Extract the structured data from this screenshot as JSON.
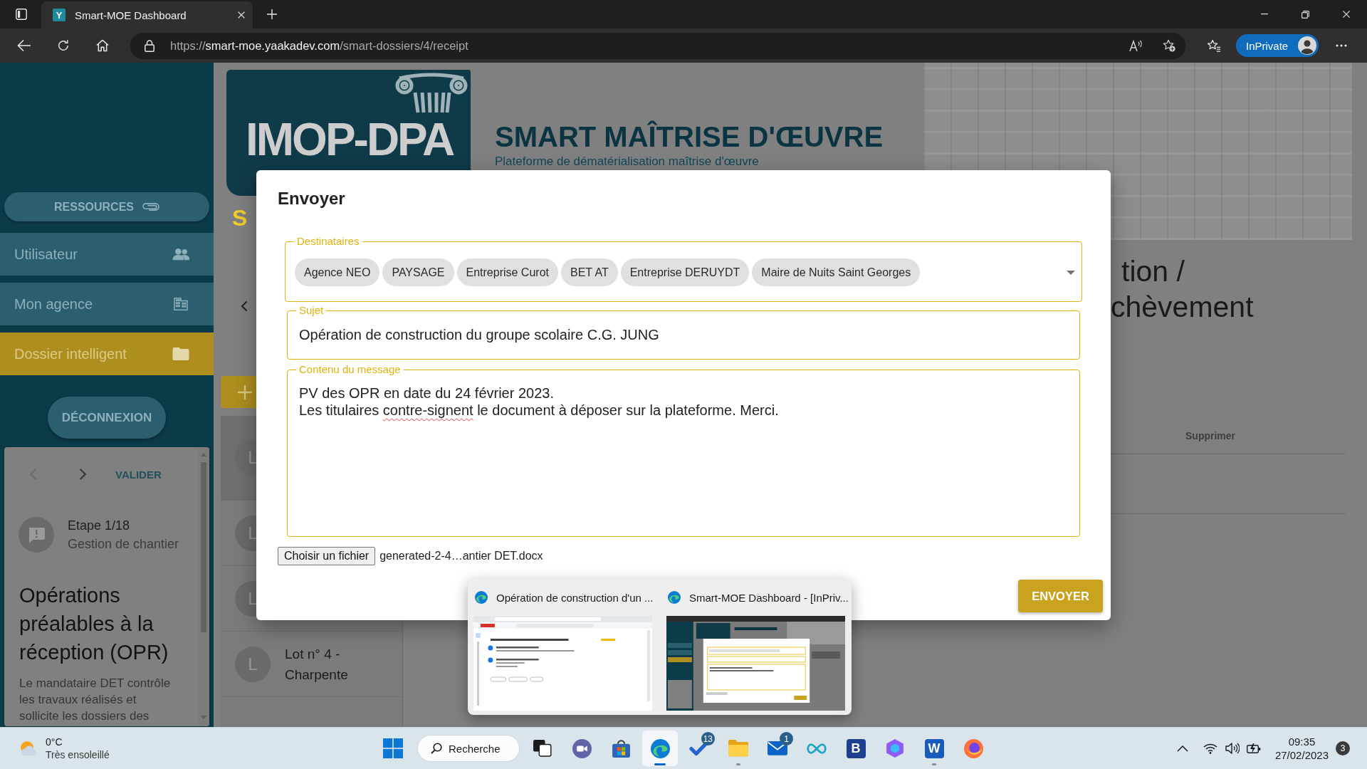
{
  "browser": {
    "tab": {
      "favicon_letter": "Y",
      "title": "Smart-MOE Dashboard",
      "selected": true
    },
    "url": {
      "scheme": "https://",
      "host": "smart-moe.yaakadev.com",
      "path": "/smart-dossiers/4/receipt"
    },
    "profile_button": "InPrivate"
  },
  "sidebar": {
    "resources_button": "RESSOURCES",
    "items": [
      {
        "kind": "users",
        "label": "Utilisateur",
        "selected": false
      },
      {
        "kind": "agency",
        "label": "Mon agence",
        "selected": false
      },
      {
        "kind": "dossier",
        "label": "Dossier intelligent",
        "selected": true
      }
    ],
    "logout_button": "DÉCONNEXION",
    "step_card": {
      "previous_disabled": true,
      "next_disabled": false,
      "validate_button": "VALIDER",
      "step": "Etape 1/18",
      "phase": "Gestion de chantier",
      "title": "Opérations préalables à la réception (OPR)",
      "description": "Le mandataire DET contrôle les travaux réalisés et sollicite les dossiers des"
    }
  },
  "header": {
    "logo_text": "IMOP-DPA",
    "logo_caption": "S",
    "title": "SMART MAÎTRISE D'ŒUVRE",
    "subtitle": "Plateforme de dématérialisation maîtrise d'œuvre"
  },
  "lots": {
    "rows": [
      {
        "avatar": "L",
        "selected": true
      },
      {
        "avatar": "L",
        "selected": false
      },
      {
        "avatar": "L",
        "selected": false
      },
      {
        "avatar": "L",
        "name": "Lot n° 4 - Charpente",
        "selected": false
      }
    ]
  },
  "page": {
    "heading_lines": [
      "tion /",
      "chèvement"
    ],
    "table": {
      "columns": [
        "Supprimer"
      ]
    }
  },
  "modal": {
    "title": "Envoyer",
    "recipients": {
      "label": "Destinataires",
      "chips": [
        "Agence NEO",
        "PAYSAGE",
        "Entreprise Curot",
        "BET AT",
        "Entreprise DERUYDT",
        "Maire de Nuits Saint Georges"
      ]
    },
    "subject": {
      "label": "Sujet",
      "value": "Opération de construction du groupe scolaire C.G. JUNG"
    },
    "message": {
      "label": "Contenu du message",
      "lines": [
        {
          "segments": [
            {
              "text": "PV des OPR en date du 24 février 2023.",
              "misspelled": false
            }
          ]
        },
        {
          "segments": [
            {
              "text": "Les titulaires ",
              "misspelled": false
            },
            {
              "text": "contre-signent",
              "misspelled": true
            },
            {
              "text": " le document à déposer sur la plateforme. Merci.",
              "misspelled": false
            }
          ]
        }
      ]
    },
    "file": {
      "button": "Choisir un fichier",
      "name": "generated-2-4…antier DET.docx"
    },
    "send_button": "ENVOYER"
  },
  "taskbar_preview": {
    "windows": [
      {
        "kind": "mail",
        "title": "Opération de construction d'un ..."
      },
      {
        "kind": "dashboard",
        "title": "Smart-MOE Dashboard - [InPriv..."
      }
    ]
  },
  "taskbar": {
    "weather": {
      "temperature": "0°C",
      "condition": "Très ensoleillé"
    },
    "search": "Recherche",
    "apps": [
      {
        "kind": "task-view",
        "selected": false,
        "open": false
      },
      {
        "kind": "chat",
        "selected": false,
        "open": false
      },
      {
        "kind": "store",
        "selected": false,
        "open": false
      },
      {
        "kind": "browser",
        "selected": true,
        "open": true
      },
      {
        "kind": "todo",
        "badge": "13",
        "selected": false,
        "open": false
      },
      {
        "kind": "files",
        "selected": false,
        "open": true
      },
      {
        "kind": "mail",
        "badge": "1",
        "selected": false,
        "open": false
      },
      {
        "kind": "infinity",
        "selected": false,
        "open": false
      },
      {
        "kind": "letter-app",
        "letter": "B",
        "selected": false,
        "open": false
      },
      {
        "kind": "hexagon",
        "selected": false,
        "open": false
      },
      {
        "kind": "word",
        "letter": "W",
        "selected": false,
        "open": true
      },
      {
        "kind": "firefox",
        "selected": false,
        "open": false
      }
    ],
    "clock": {
      "time": "09:35",
      "date": "27/02/2023"
    },
    "notifications": "3"
  }
}
